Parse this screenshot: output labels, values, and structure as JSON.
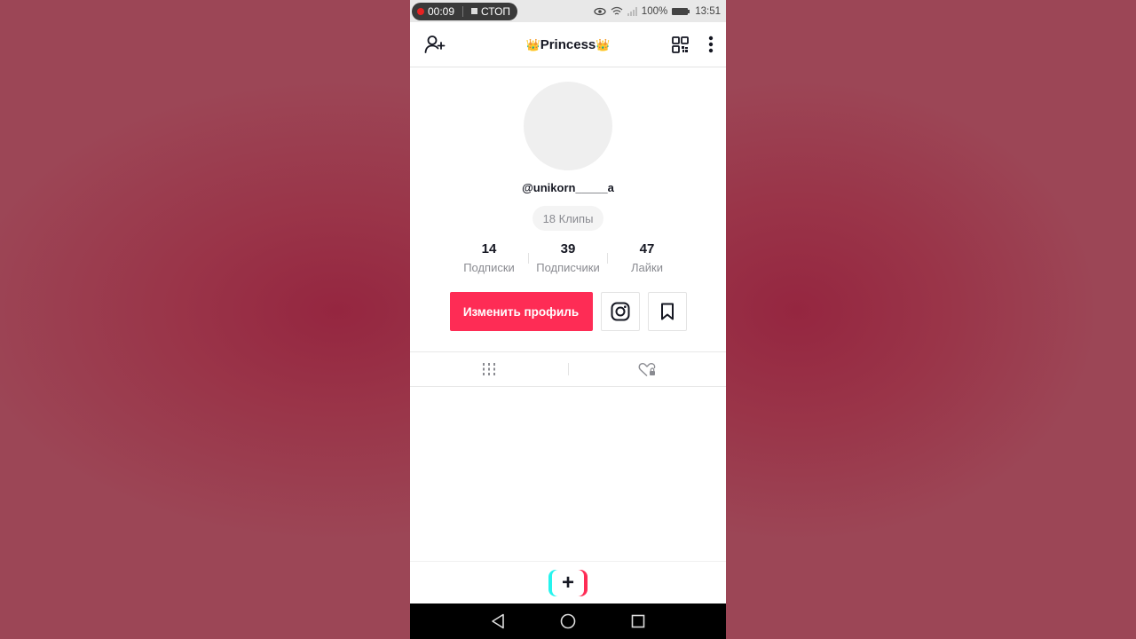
{
  "status_bar": {
    "recording_time": "00:09",
    "stop_label": "СТОП",
    "battery": "100%",
    "time": "13:51",
    "icons": [
      "eye-icon",
      "wifi-icon",
      "signal-icon",
      "battery-icon"
    ]
  },
  "header": {
    "title": "Princess",
    "title_emoji": "👑",
    "left_icon": "add-user-icon",
    "right_icons": [
      "qr-code-icon",
      "more-vertical-icon"
    ]
  },
  "profile": {
    "username": "@unikorn_____a",
    "clips_label": "18 Клипы",
    "stats": [
      {
        "value": "14",
        "label": "Подписки"
      },
      {
        "value": "39",
        "label": "Подписчики"
      },
      {
        "value": "47",
        "label": "Лайки"
      }
    ],
    "edit_button": "Изменить профиль",
    "instagram_icon": "instagram-icon",
    "bookmark_icon": "bookmark-icon"
  },
  "tabs": [
    {
      "icon": "grid-videos-icon",
      "active": true
    },
    {
      "icon": "liked-private-icon",
      "active": false
    }
  ],
  "bottom_bar": {
    "create_icon": "plus-icon",
    "create_symbol": "+"
  },
  "nav_bar": {
    "keys": [
      "back-icon",
      "home-icon",
      "recents-icon"
    ]
  },
  "colors": {
    "accent": "#fe2c55",
    "tiktok_cyan": "#25f4ee",
    "text_primary": "#161823",
    "text_secondary": "#8a8b91",
    "background_outer": "#9a3549"
  }
}
